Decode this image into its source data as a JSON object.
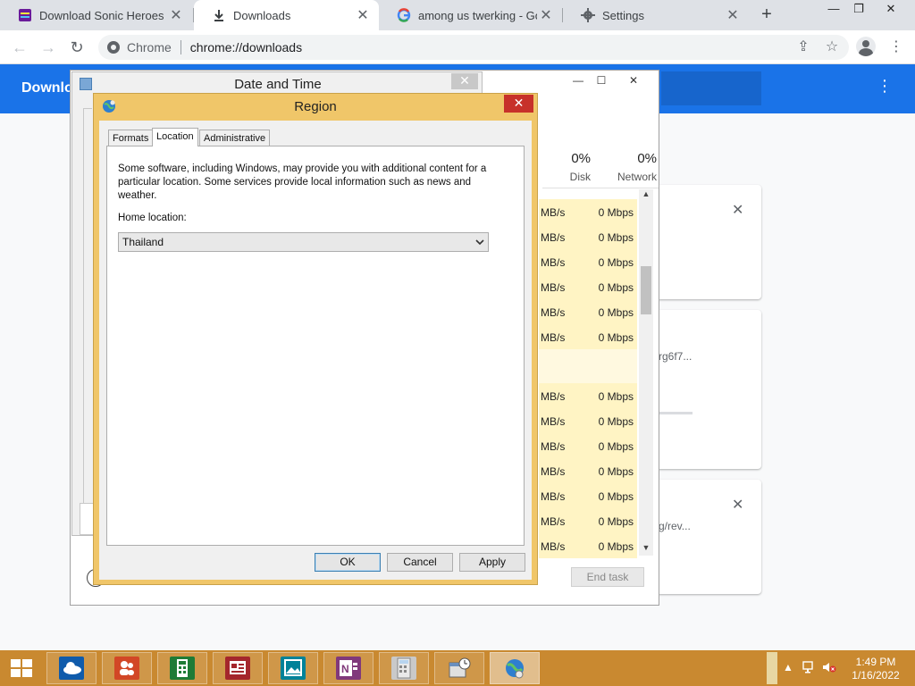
{
  "chrome": {
    "tabs": [
      {
        "title": "Download Sonic Heroes (W",
        "close": "✕"
      },
      {
        "title": "Downloads",
        "close": "✕"
      },
      {
        "title": "among us twerking - Goo",
        "close": "✕"
      },
      {
        "title": "Settings",
        "close": "✕"
      }
    ],
    "new_tab": "+",
    "window_controls": {
      "minimize": "—",
      "restore": "❐",
      "close": "✕"
    },
    "address": {
      "scheme": "Chrome",
      "url": "chrome://downloads"
    },
    "nav": {
      "back": "←",
      "forward": "→",
      "reload": "↻"
    },
    "toolbar_icons": {
      "share": "⇪",
      "bookmark": "☆",
      "menu": "⋮"
    }
  },
  "downloads": {
    "header_title": "Downlo",
    "menu": "⋮",
    "cards": [
      {
        "close": "✕",
        "text": ""
      },
      {
        "close": "",
        "text": "rg6f7..."
      },
      {
        "close": "✕",
        "text": "g/rev..."
      }
    ]
  },
  "task_manager": {
    "controls": {
      "minimize": "—",
      "maximize": "☐",
      "close": "✕"
    },
    "headers": [
      {
        "pct": "0%",
        "label": "Disk"
      },
      {
        "pct": "0%",
        "label": "Network"
      }
    ],
    "rows": [
      {
        "disk": "MB/s",
        "network": "0 Mbps"
      },
      {
        "disk": "MB/s",
        "network": "0 Mbps"
      },
      {
        "disk": "MB/s",
        "network": "0 Mbps"
      },
      {
        "disk": "MB/s",
        "network": "0 Mbps"
      },
      {
        "disk": "MB/s",
        "network": "0 Mbps"
      },
      {
        "disk": "MB/s",
        "network": "0 Mbps"
      },
      {
        "disk": "",
        "network": ""
      },
      {
        "disk": "MB/s",
        "network": "0 Mbps"
      },
      {
        "disk": "MB/s",
        "network": "0 Mbps"
      },
      {
        "disk": "MB/s",
        "network": "0 Mbps"
      },
      {
        "disk": "MB/s",
        "network": "0 Mbps"
      },
      {
        "disk": "MB/s",
        "network": "0 Mbps"
      },
      {
        "disk": "MB/s",
        "network": "0 Mbps"
      },
      {
        "disk": "MB/s",
        "network": "0 Mbps"
      }
    ],
    "end_task": "End task"
  },
  "date_time": {
    "title": "Date and Time",
    "close": "✕"
  },
  "region": {
    "title": "Region",
    "close": "✕",
    "tabs": [
      "Formats",
      "Location",
      "Administrative"
    ],
    "active_tab": "Location",
    "description": "Some software, including Windows, may provide you with additional content for a particular location. Some services provide local information such as news and weather.",
    "home_location_label": "Home location:",
    "home_location_value": "Thailand",
    "buttons": {
      "ok": "OK",
      "cancel": "Cancel",
      "apply": "Apply"
    }
  },
  "taskbar": {
    "apps": [
      "onedrive",
      "people",
      "calculator-excel",
      "news",
      "photos",
      "onenote",
      "calculator",
      "date-time",
      "region-globe"
    ],
    "clock": {
      "time": "1:49 PM",
      "date": "1/16/2022"
    },
    "colors": {
      "taskbar": "#c98930",
      "region_frame": "#f0c669",
      "chrome_accent": "#1a73e8"
    }
  }
}
